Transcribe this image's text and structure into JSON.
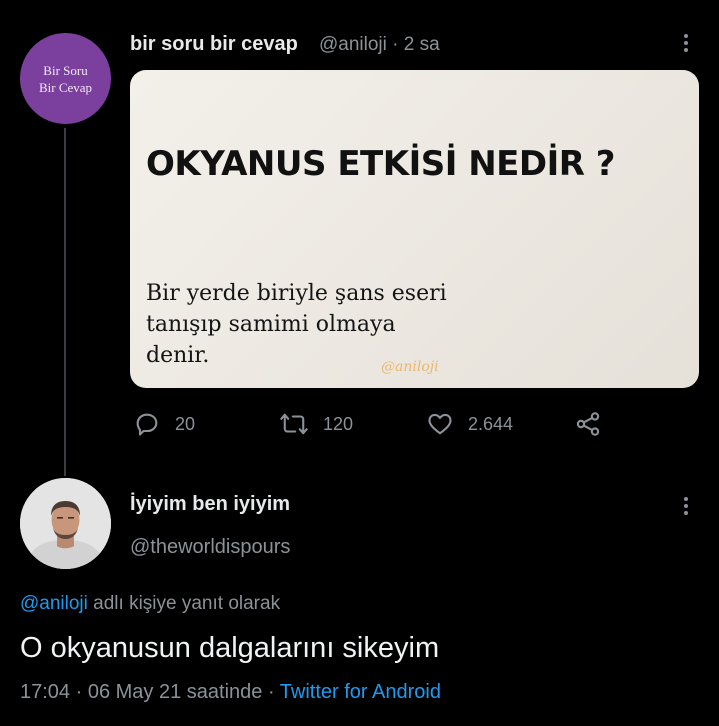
{
  "tweet": {
    "avatar_text_line1": "Bir Soru",
    "avatar_text_line2": "Bir Cevap",
    "display_name": "bir soru bir cevap",
    "handle": "@aniloji",
    "separator": "·",
    "time": "2 sa",
    "image": {
      "title": "OKYANUS ETKİSİ NEDİR ?",
      "body_line1": "Bir yerde biriyle şans eseri",
      "body_line2": "tanışıp samimi olmaya",
      "body_line3": "denir.",
      "watermark": "@aniloji"
    },
    "actions": {
      "replies": "20",
      "retweets": "120",
      "likes": "2.644"
    }
  },
  "reply": {
    "display_name": "İyiyim ben iyiyim",
    "handle": "@theworldispours",
    "reply_to_mention": "@aniloji",
    "reply_to_suffix": " adlı kişiye yanıt olarak",
    "text": "O okyanusun dalgalarını sikeyim",
    "timestamp": "17:04 · 06 May 21 saatinde · ",
    "client": "Twitter for Android"
  },
  "colors": {
    "background": "#000000",
    "accent": "#1d9bf0",
    "secondary_text": "#8b9298",
    "avatar_purple": "#7b3f9e"
  }
}
